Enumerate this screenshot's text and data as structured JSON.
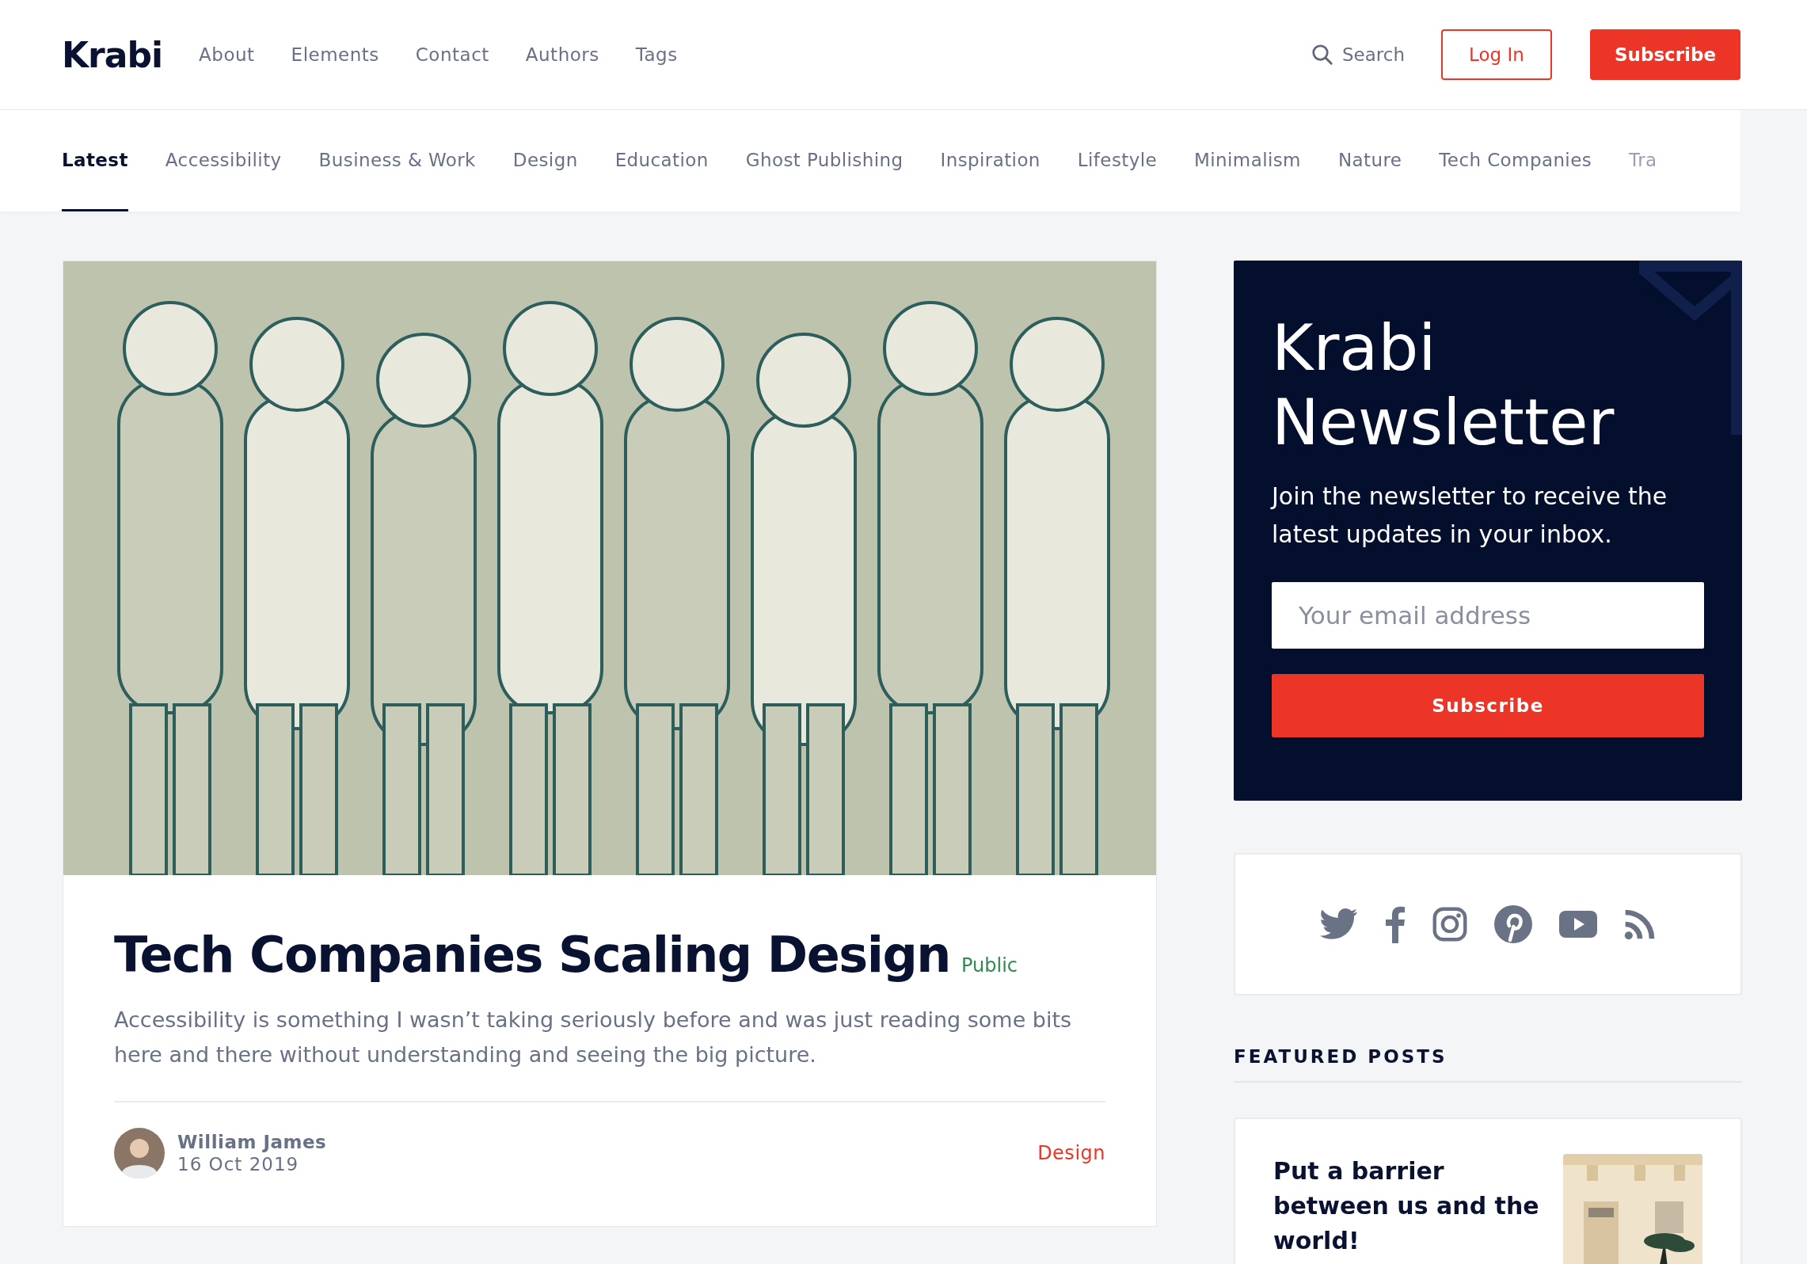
{
  "header": {
    "logo": "Krabi",
    "nav": [
      "About",
      "Elements",
      "Contact",
      "Authors",
      "Tags"
    ],
    "search": "Search",
    "login": "Log In",
    "subscribe": "Subscribe"
  },
  "tags": [
    {
      "label": "Latest",
      "selected": true
    },
    {
      "label": "Accessibility",
      "selected": false
    },
    {
      "label": "Business & Work",
      "selected": false
    },
    {
      "label": "Design",
      "selected": false
    },
    {
      "label": "Education",
      "selected": false
    },
    {
      "label": "Ghost Publishing",
      "selected": false
    },
    {
      "label": "Inspiration",
      "selected": false
    },
    {
      "label": "Lifestyle",
      "selected": false
    },
    {
      "label": "Minimalism",
      "selected": false
    },
    {
      "label": "Nature",
      "selected": false
    },
    {
      "label": "Tech Companies",
      "selected": false
    },
    {
      "label": "Tra",
      "selected": false
    }
  ],
  "post": {
    "title": "Tech Companies Scaling Design",
    "visibility": "Public",
    "excerpt": "Accessibility is something I wasn’t taking seriously before and was just reading some bits here and there without understanding and seeing the big picture.",
    "author": "William James",
    "date": "16 Oct 2019",
    "tag": "Design"
  },
  "newsletter": {
    "title": "Krabi Newsletter",
    "text": "Join the newsletter to receive the latest updates in your inbox.",
    "placeholder": "Your email address",
    "button": "Subscribe"
  },
  "featured": {
    "heading": "FEATURED POSTS",
    "posts": [
      {
        "title": "Put a barrier between us and the world!"
      }
    ]
  }
}
